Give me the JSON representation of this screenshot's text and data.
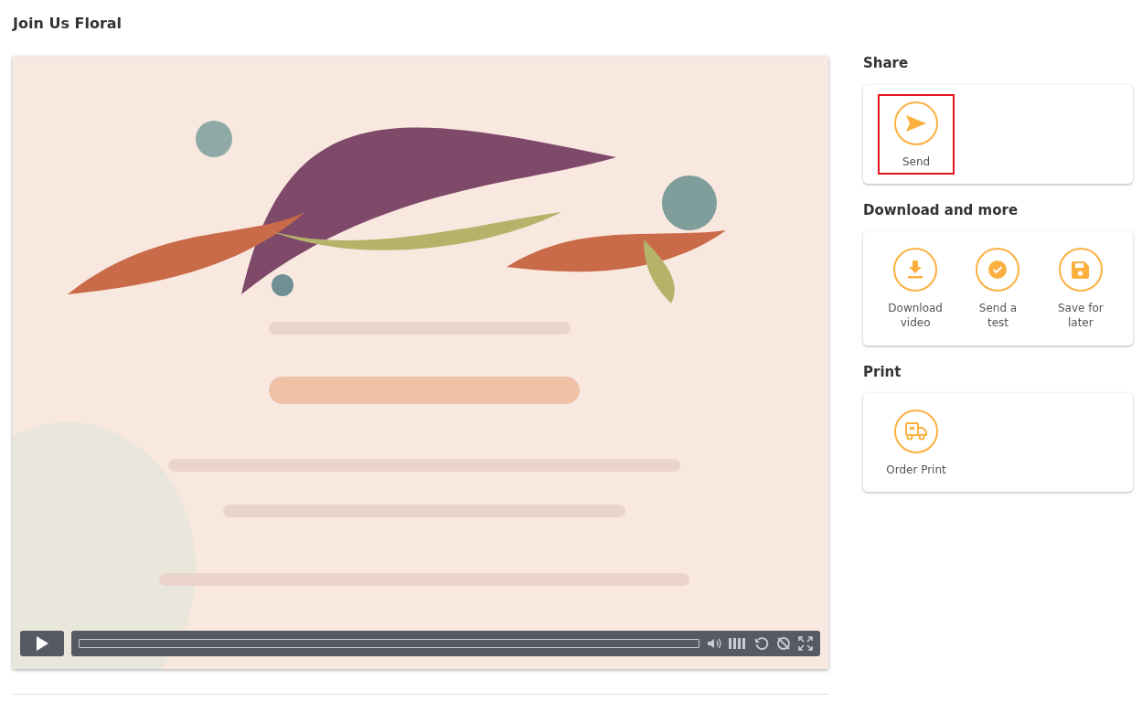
{
  "page_title": "Join Us Floral",
  "sections": [
    {
      "heading": "Share",
      "actions": [
        {
          "kind": "send",
          "label": "Send",
          "highlighted": true
        }
      ]
    },
    {
      "heading": "Download and more",
      "actions": [
        {
          "kind": "download",
          "label": "Download video",
          "highlighted": false
        },
        {
          "kind": "check",
          "label": "Send a test",
          "highlighted": false
        },
        {
          "kind": "save",
          "label": "Save for later",
          "highlighted": false
        }
      ]
    },
    {
      "heading": "Print",
      "actions": [
        {
          "kind": "truck",
          "label": "Order Print",
          "highlighted": false
        }
      ]
    }
  ]
}
